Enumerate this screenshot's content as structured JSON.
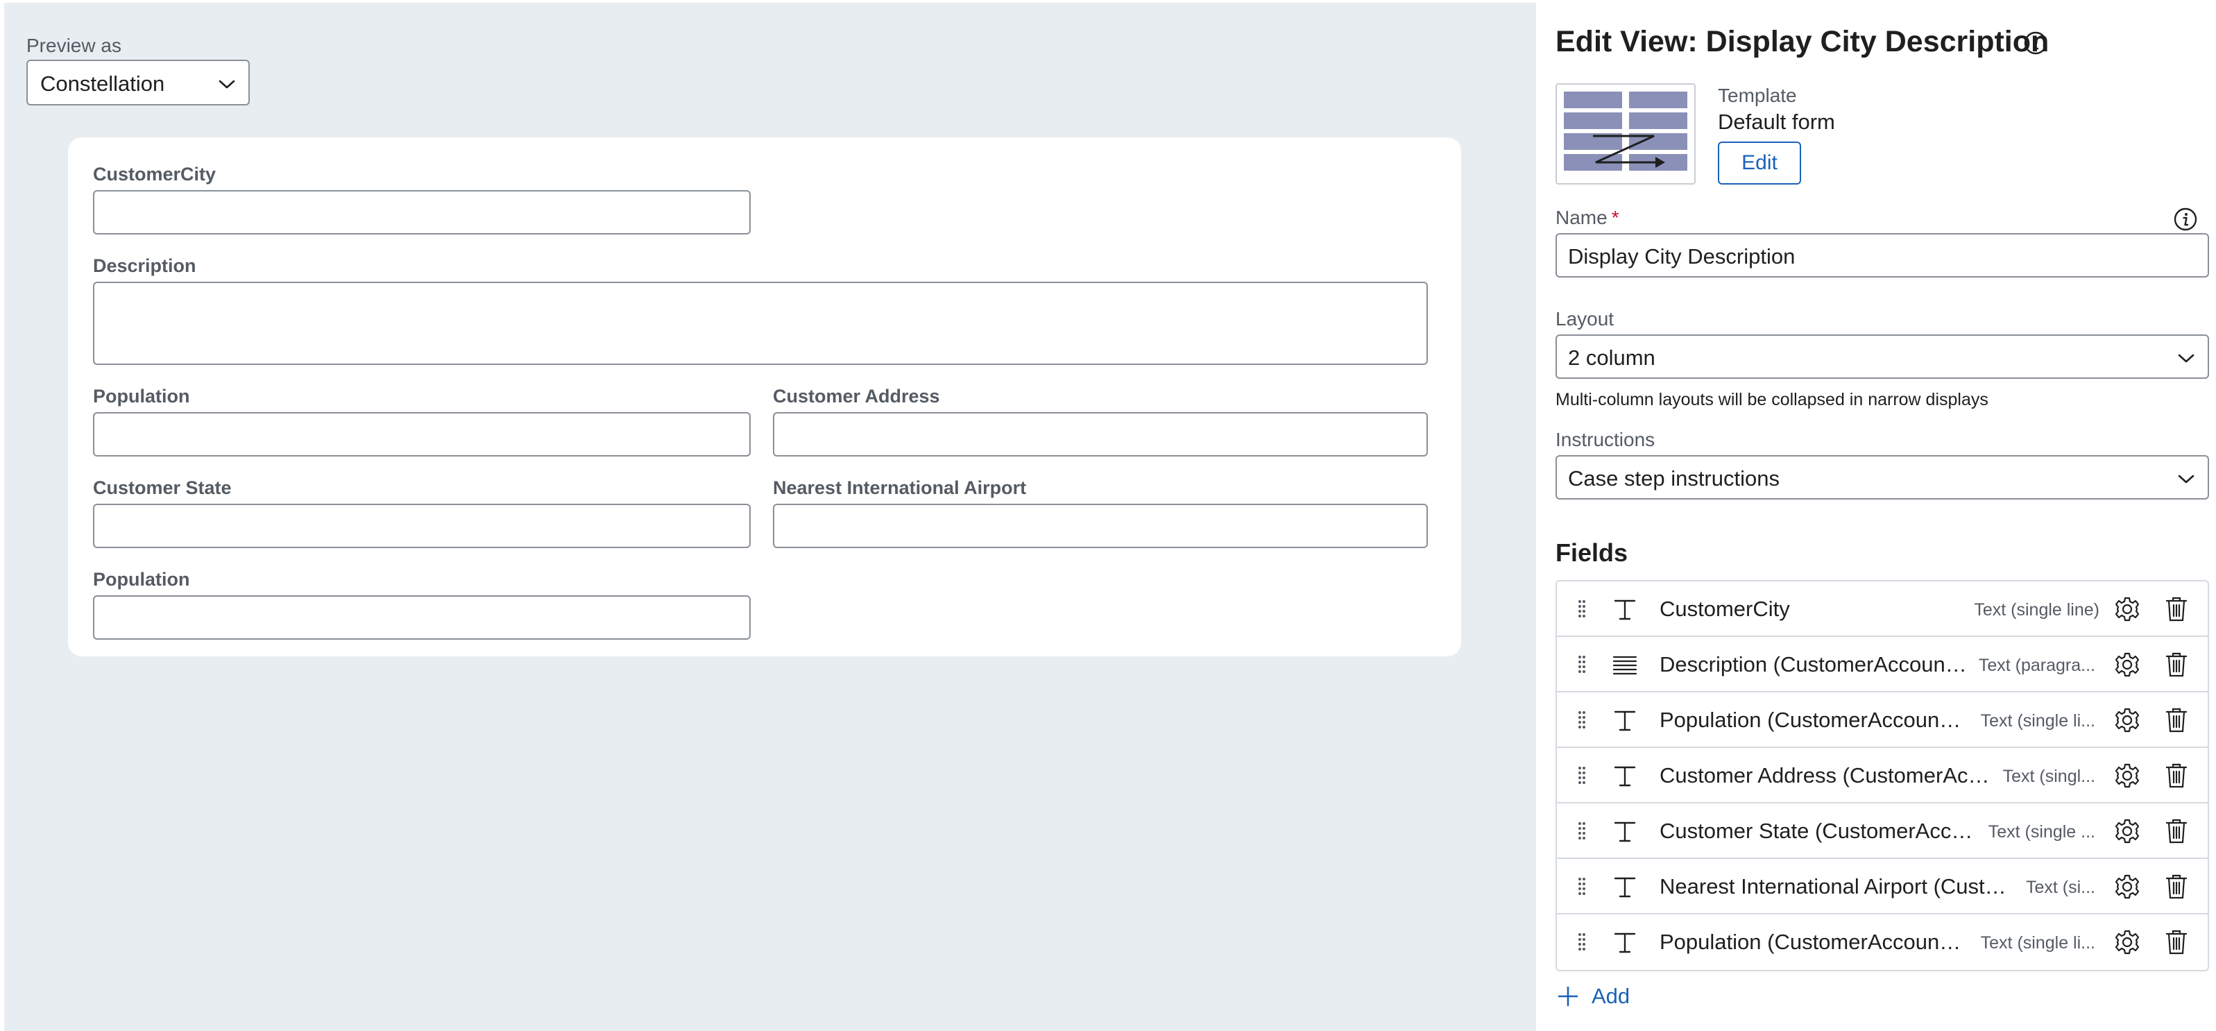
{
  "preview": {
    "label": "Preview as",
    "selected": "Constellation"
  },
  "form": {
    "fields": [
      {
        "label": "CustomerCity"
      },
      {
        "label": "Description"
      },
      {
        "label": "Population"
      },
      {
        "label": "Customer Address"
      },
      {
        "label": "Customer State"
      },
      {
        "label": "Nearest International Airport"
      },
      {
        "label": "Population"
      }
    ]
  },
  "panel": {
    "title": "Edit View: Display City Description",
    "template_label": "Template",
    "template_value": "Default form",
    "edit_button": "Edit",
    "name_label": "Name",
    "required_marker": "*",
    "name_value": "Display City Description",
    "layout_label": "Layout",
    "layout_value": "2 column",
    "layout_hint": "Multi-column layouts will be collapsed in narrow displays",
    "instructions_label": "Instructions",
    "instructions_value": "Case step instructions",
    "fields_heading": "Fields",
    "add_label": "Add"
  },
  "fields_list": [
    {
      "name": "CustomerCity",
      "type": "Text (single line)",
      "icon": "text-icon"
    },
    {
      "name": "Description (CustomerAccountIn...",
      "type": "Text (paragra...",
      "icon": "paragraph-icon"
    },
    {
      "name": "Population (CustomerAccountIn...",
      "type": "Text (single li...",
      "icon": "text-icon"
    },
    {
      "name": "Customer Address (CustomerAcco...",
      "type": "Text (singl...",
      "icon": "text-icon"
    },
    {
      "name": "Customer State (CustomerAccoun...",
      "type": "Text (single ...",
      "icon": "text-icon"
    },
    {
      "name": "Nearest International Airport (Custo...",
      "type": "Text (si...",
      "icon": "text-icon"
    },
    {
      "name": "Population (CustomerAccountIn...",
      "type": "Text (single li...",
      "icon": "text-icon"
    }
  ],
  "colors": {
    "preview_background": "#e8edf2",
    "accent": "#1a62b8",
    "required": "#c8102e",
    "border": "#8a9097"
  }
}
